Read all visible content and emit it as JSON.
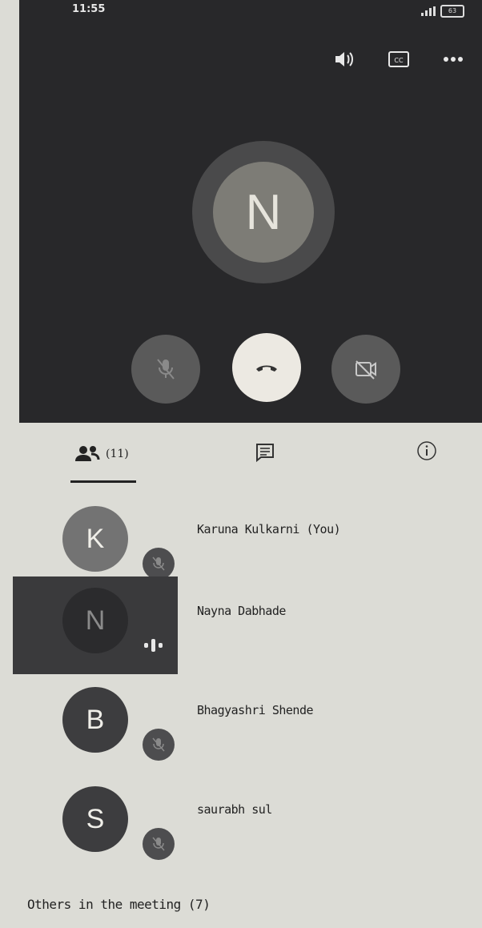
{
  "status_bar": {
    "time": "11:55",
    "battery": "63"
  },
  "top_icons": [
    "speaker-icon",
    "captions-icon",
    "more-icon"
  ],
  "main_avatar": {
    "initial": "N"
  },
  "controls": [
    "mic-off-icon",
    "end-call-icon",
    "camera-off-icon"
  ],
  "tabs": {
    "people_count": "(11)"
  },
  "participants": [
    {
      "initial": "K",
      "name": "Karuna Kulkarni (You)",
      "color": "#737373",
      "status": "muted"
    },
    {
      "initial": "N",
      "name": "Nayna Dabhade",
      "color": "#2b2b2d",
      "status": "speaking"
    },
    {
      "initial": "B",
      "name": "Bhagyashri Shende",
      "color": "#3d3d3f",
      "status": "muted"
    },
    {
      "initial": "S",
      "name": "saurabh sul",
      "color": "#3d3d3f",
      "status": "muted"
    }
  ],
  "others": {
    "label": "Others in the meeting (7)"
  }
}
